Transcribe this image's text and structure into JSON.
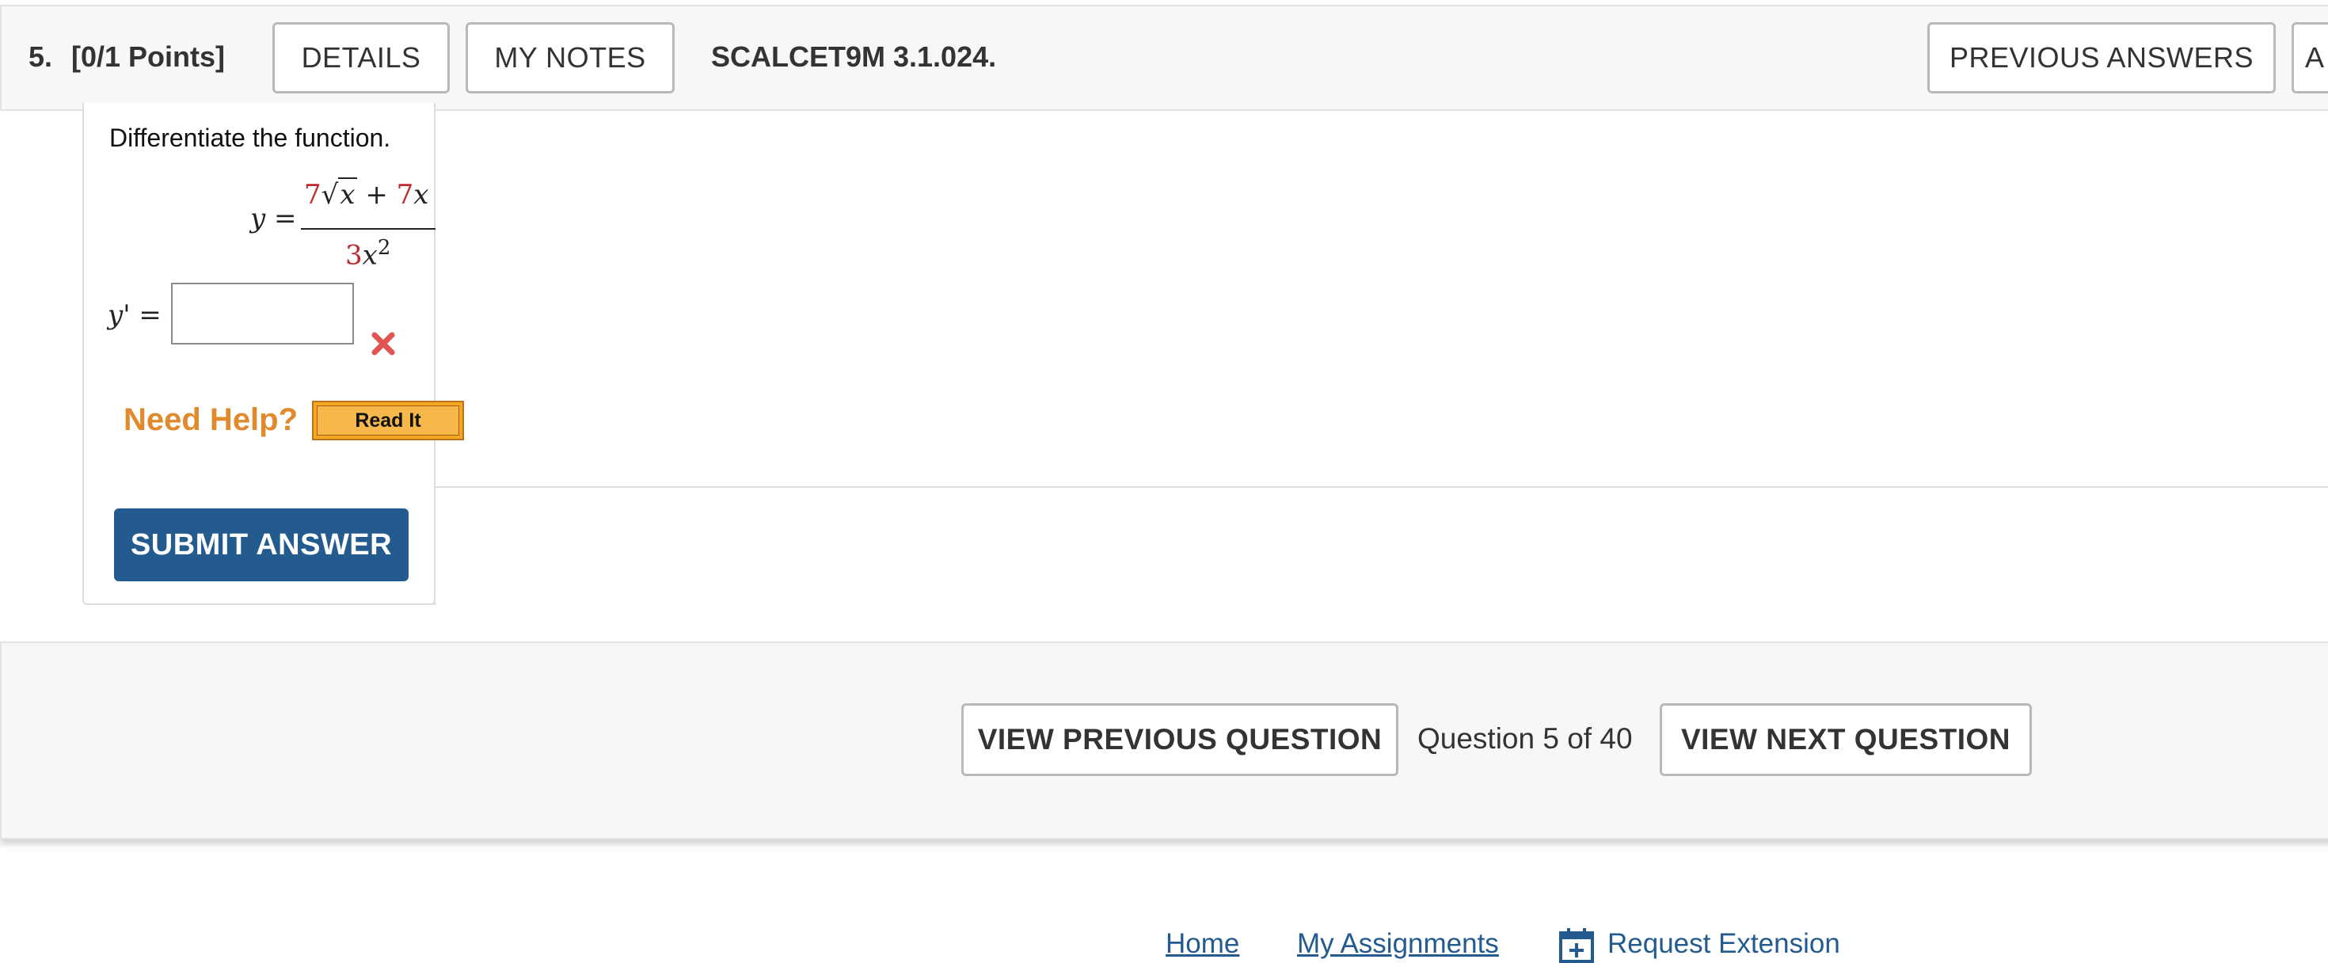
{
  "header": {
    "question_number": "5.",
    "points": "[0/1 Points]",
    "details_label": "DETAILS",
    "my_notes_label": "MY NOTES",
    "problem_id": "SCALCET9M 3.1.024.",
    "previous_answers_label": "PREVIOUS ANSWERS",
    "ask_label_partial": "A"
  },
  "question": {
    "prompt": "Differentiate the function.",
    "function_lhs": "y =",
    "numerator": {
      "coef1": "7",
      "radical_symbol": "√",
      "radicand": "x",
      "plus": "+",
      "coef2": "7",
      "var": "x"
    },
    "denominator": {
      "coef": "3",
      "var": "x",
      "exponent": "2"
    },
    "answer_label": "y' =",
    "answer_value": "",
    "answer_status_icon": "incorrect-x-icon",
    "incorrect_color": "#e05454"
  },
  "help": {
    "need_help_label": "Need Help?",
    "read_it_label": "Read It"
  },
  "submit_label": "SUBMIT ANSWER",
  "navigation": {
    "prev_label": "VIEW PREVIOUS QUESTION",
    "position_text": "Question 5 of 40",
    "next_label": "VIEW NEXT QUESTION"
  },
  "footer": {
    "home_label": "Home",
    "my_assignments_label": "My Assignments",
    "request_extension_label": "Request Extension",
    "extension_icon": "calendar-plus-icon"
  },
  "colors": {
    "brand_blue": "#245b8f",
    "help_orange": "#e08a2b",
    "math_red": "#c0282d"
  }
}
